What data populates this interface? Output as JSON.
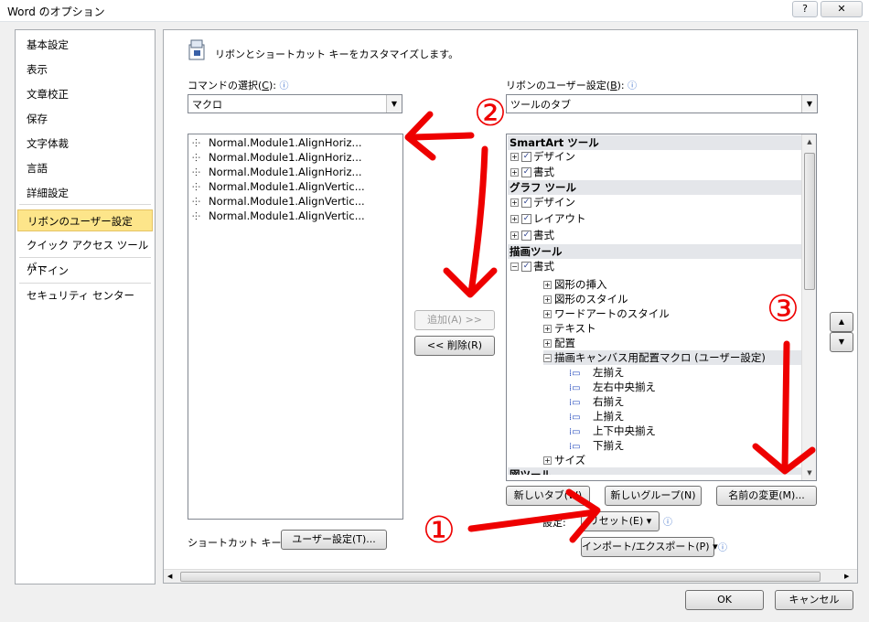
{
  "window": {
    "title": "Word のオプション",
    "help_glyph": "?",
    "close_glyph": "✕"
  },
  "sidebar": {
    "items": [
      {
        "label": "基本設定"
      },
      {
        "label": "表示"
      },
      {
        "label": "文章校正"
      },
      {
        "label": "保存"
      },
      {
        "label": "文字体裁"
      },
      {
        "label": "言語"
      },
      {
        "label": "詳細設定"
      },
      {
        "label": "リボンのユーザー設定",
        "selected": true
      },
      {
        "label": "クイック アクセス ツール バー"
      },
      {
        "label": "アドイン"
      },
      {
        "label": "セキュリティ センター"
      }
    ]
  },
  "header": {
    "text": "リボンとショートカット キーをカスタマイズします。"
  },
  "commands": {
    "label": "コマンドの選択(",
    "label_key": "C",
    "label_end": "):",
    "selected": "マクロ",
    "items": [
      "Normal.Module1.AlignHoriz...",
      "Normal.Module1.AlignHoriz...",
      "Normal.Module1.AlignHoriz...",
      "Normal.Module1.AlignVertic...",
      "Normal.Module1.AlignVertic...",
      "Normal.Module1.AlignVertic..."
    ]
  },
  "ribbon": {
    "label": "リボンのユーザー設定(",
    "label_key": "B",
    "label_end": "):",
    "selected": "ツールのタブ",
    "tree": [
      {
        "text": "SmartArt ツール",
        "kind": "group"
      },
      {
        "text": "デザイン",
        "kind": "tab",
        "checked": true
      },
      {
        "text": "書式",
        "kind": "tab",
        "checked": true
      },
      {
        "text": "グラフ ツール",
        "kind": "group"
      },
      {
        "text": "デザイン",
        "kind": "tab",
        "checked": true
      },
      {
        "text": "レイアウト",
        "kind": "tab",
        "checked": true
      },
      {
        "text": "書式",
        "kind": "tab",
        "checked": true
      },
      {
        "text": "描画ツール",
        "kind": "group"
      },
      {
        "text": "書式",
        "kind": "tab-open",
        "checked": true
      },
      {
        "text": "図形の挿入",
        "kind": "sub"
      },
      {
        "text": "図形のスタイル",
        "kind": "sub"
      },
      {
        "text": "ワードアートのスタイル",
        "kind": "sub"
      },
      {
        "text": "テキスト",
        "kind": "sub"
      },
      {
        "text": "配置",
        "kind": "sub"
      },
      {
        "text": "描画キャンバス用配置マクロ (ユーザー設定)",
        "kind": "sub-open"
      },
      {
        "text": "左揃え",
        "kind": "macro"
      },
      {
        "text": "左右中央揃え",
        "kind": "macro"
      },
      {
        "text": "右揃え",
        "kind": "macro"
      },
      {
        "text": "上揃え",
        "kind": "macro"
      },
      {
        "text": "上下中央揃え",
        "kind": "macro"
      },
      {
        "text": "下揃え",
        "kind": "macro"
      },
      {
        "text": "サイズ",
        "kind": "sub"
      },
      {
        "text": "図ツール",
        "kind": "group-cut"
      }
    ]
  },
  "buttons": {
    "add": "追加(A) >>",
    "remove": "<< 削除(R)",
    "new_tab": "新しいタブ(W)",
    "new_group": "新しいグループ(N)",
    "rename": "名前の変更(M)...",
    "reset": "リセット(E) ▾",
    "import_export": "インポート/エクスポート(P) ▾",
    "shortcut_customize": "ユーザー設定(T)...",
    "ok": "OK",
    "cancel": "キャンセル",
    "move_up": "▲",
    "move_down": "▼"
  },
  "labels": {
    "custom_settings": "設定:",
    "shortcut_keys": "ショートカット キー:",
    "info_glyph": "ⓘ"
  },
  "annotations": {
    "one": "①",
    "two": "②",
    "three": "③",
    "arrow_color": "#ee0000"
  },
  "colors": {
    "selected_bg": "#fde58a",
    "accent": "#3b6ec9"
  }
}
